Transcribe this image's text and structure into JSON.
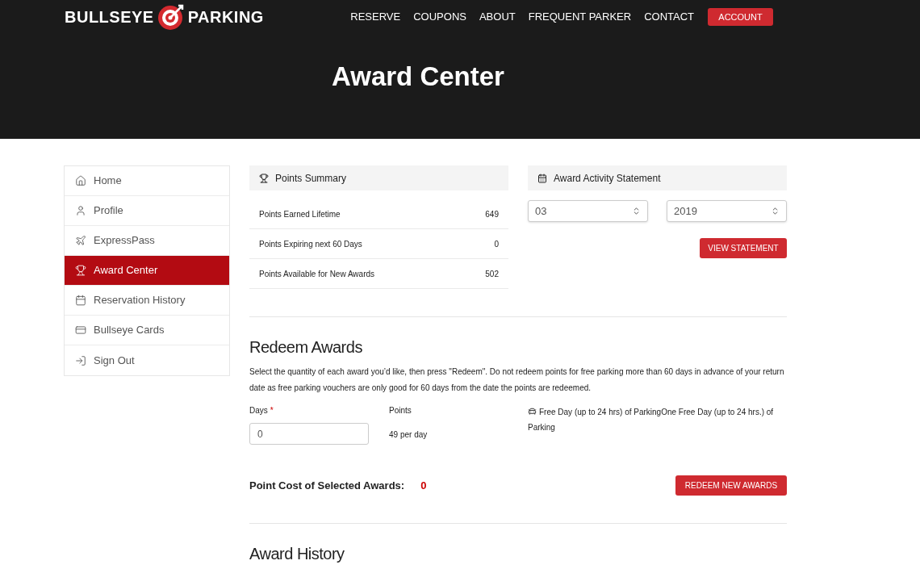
{
  "header": {
    "logo": {
      "left": "BULLSEYE",
      "right": "PARKING"
    },
    "nav": [
      {
        "label": "RESERVE"
      },
      {
        "label": "COUPONS"
      },
      {
        "label": "ABOUT"
      },
      {
        "label": "FREQUENT PARKER"
      },
      {
        "label": "CONTACT"
      }
    ],
    "account_button": "ACCOUNT",
    "page_title": "Award Center"
  },
  "sidebar": {
    "items": [
      {
        "label": "Home",
        "selected": false
      },
      {
        "label": "Profile",
        "selected": false
      },
      {
        "label": "ExpressPass",
        "selected": false
      },
      {
        "label": "Award Center",
        "selected": true
      },
      {
        "label": "Reservation History",
        "selected": false
      },
      {
        "label": "Bullseye Cards",
        "selected": false
      },
      {
        "label": "Sign Out",
        "selected": false
      }
    ]
  },
  "points_summary": {
    "title": "Points Summary",
    "rows": [
      {
        "label": "Points Earned Lifetime",
        "value": "649"
      },
      {
        "label": "Points Expiring next 60 Days",
        "value": "0"
      },
      {
        "label": "Points Available for New Awards",
        "value": "502"
      }
    ]
  },
  "statement": {
    "title": "Award Activity Statement",
    "month": "03",
    "year": "2019",
    "button": "VIEW STATEMENT"
  },
  "redeem": {
    "title": "Redeem Awards",
    "description": "Select the quantity of each award you’d like, then press \"Redeem\". Do not redeem points for free parking more than 60 days in advance of your return date as free parking vouchers are only good for 60 days from the date the points are redeemed.",
    "days_label": "Days",
    "required_mark": "*",
    "days_value": "0",
    "points_label": "Points",
    "points_value": "49 per day",
    "award_description": "Free Day (up to 24 hrs) of ParkingOne Free Day (up to 24 hrs.) of Parking",
    "cost_label": "Point Cost of Selected Awards:",
    "cost_value": "0",
    "button": "REDEEM NEW AWARDS"
  },
  "history": {
    "title": "Award History"
  }
}
